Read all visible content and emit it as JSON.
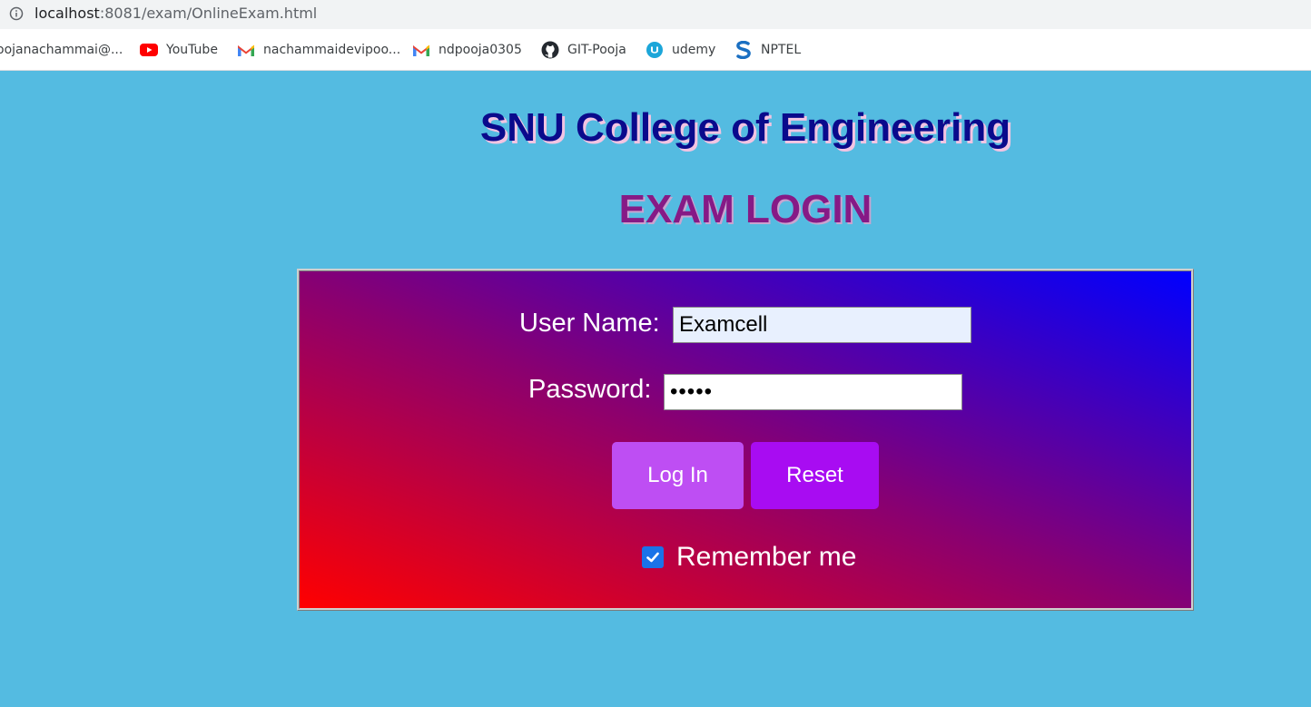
{
  "browser": {
    "url_host": "localhost",
    "url_rest": ":8081/exam/OnlineExam.html",
    "bookmarks": [
      {
        "label": "oojanachammai@...",
        "icon": "none"
      },
      {
        "label": "YouTube",
        "icon": "youtube-icon"
      },
      {
        "label": "nachammaidevipoo...",
        "icon": "gmail-icon"
      },
      {
        "label": "ndpooja0305",
        "icon": "gmail-icon"
      },
      {
        "label": "GIT-Pooja",
        "icon": "github-icon"
      },
      {
        "label": "udemy",
        "icon": "udemy-icon"
      },
      {
        "label": "NPTEL",
        "icon": "nptel-icon"
      }
    ]
  },
  "page": {
    "college_title": "SNU College of Engineering",
    "login_heading": "EXAM LOGIN",
    "colors": {
      "background": "#54bbe1",
      "college_title": "#0a0a8c",
      "login_heading": "#861a86",
      "panel_gradient_start": "#ff0000",
      "panel_gradient_end": "#0000ff",
      "login_button": "#be4ef3",
      "reset_button": "#a80cf2"
    }
  },
  "form": {
    "username_label": "User Name:",
    "username_value": "Examcell",
    "password_label": "Password:",
    "password_value": "•••••",
    "login_button": "Log In",
    "reset_button": "Reset",
    "remember_label": "Remember me",
    "remember_checked": true
  }
}
